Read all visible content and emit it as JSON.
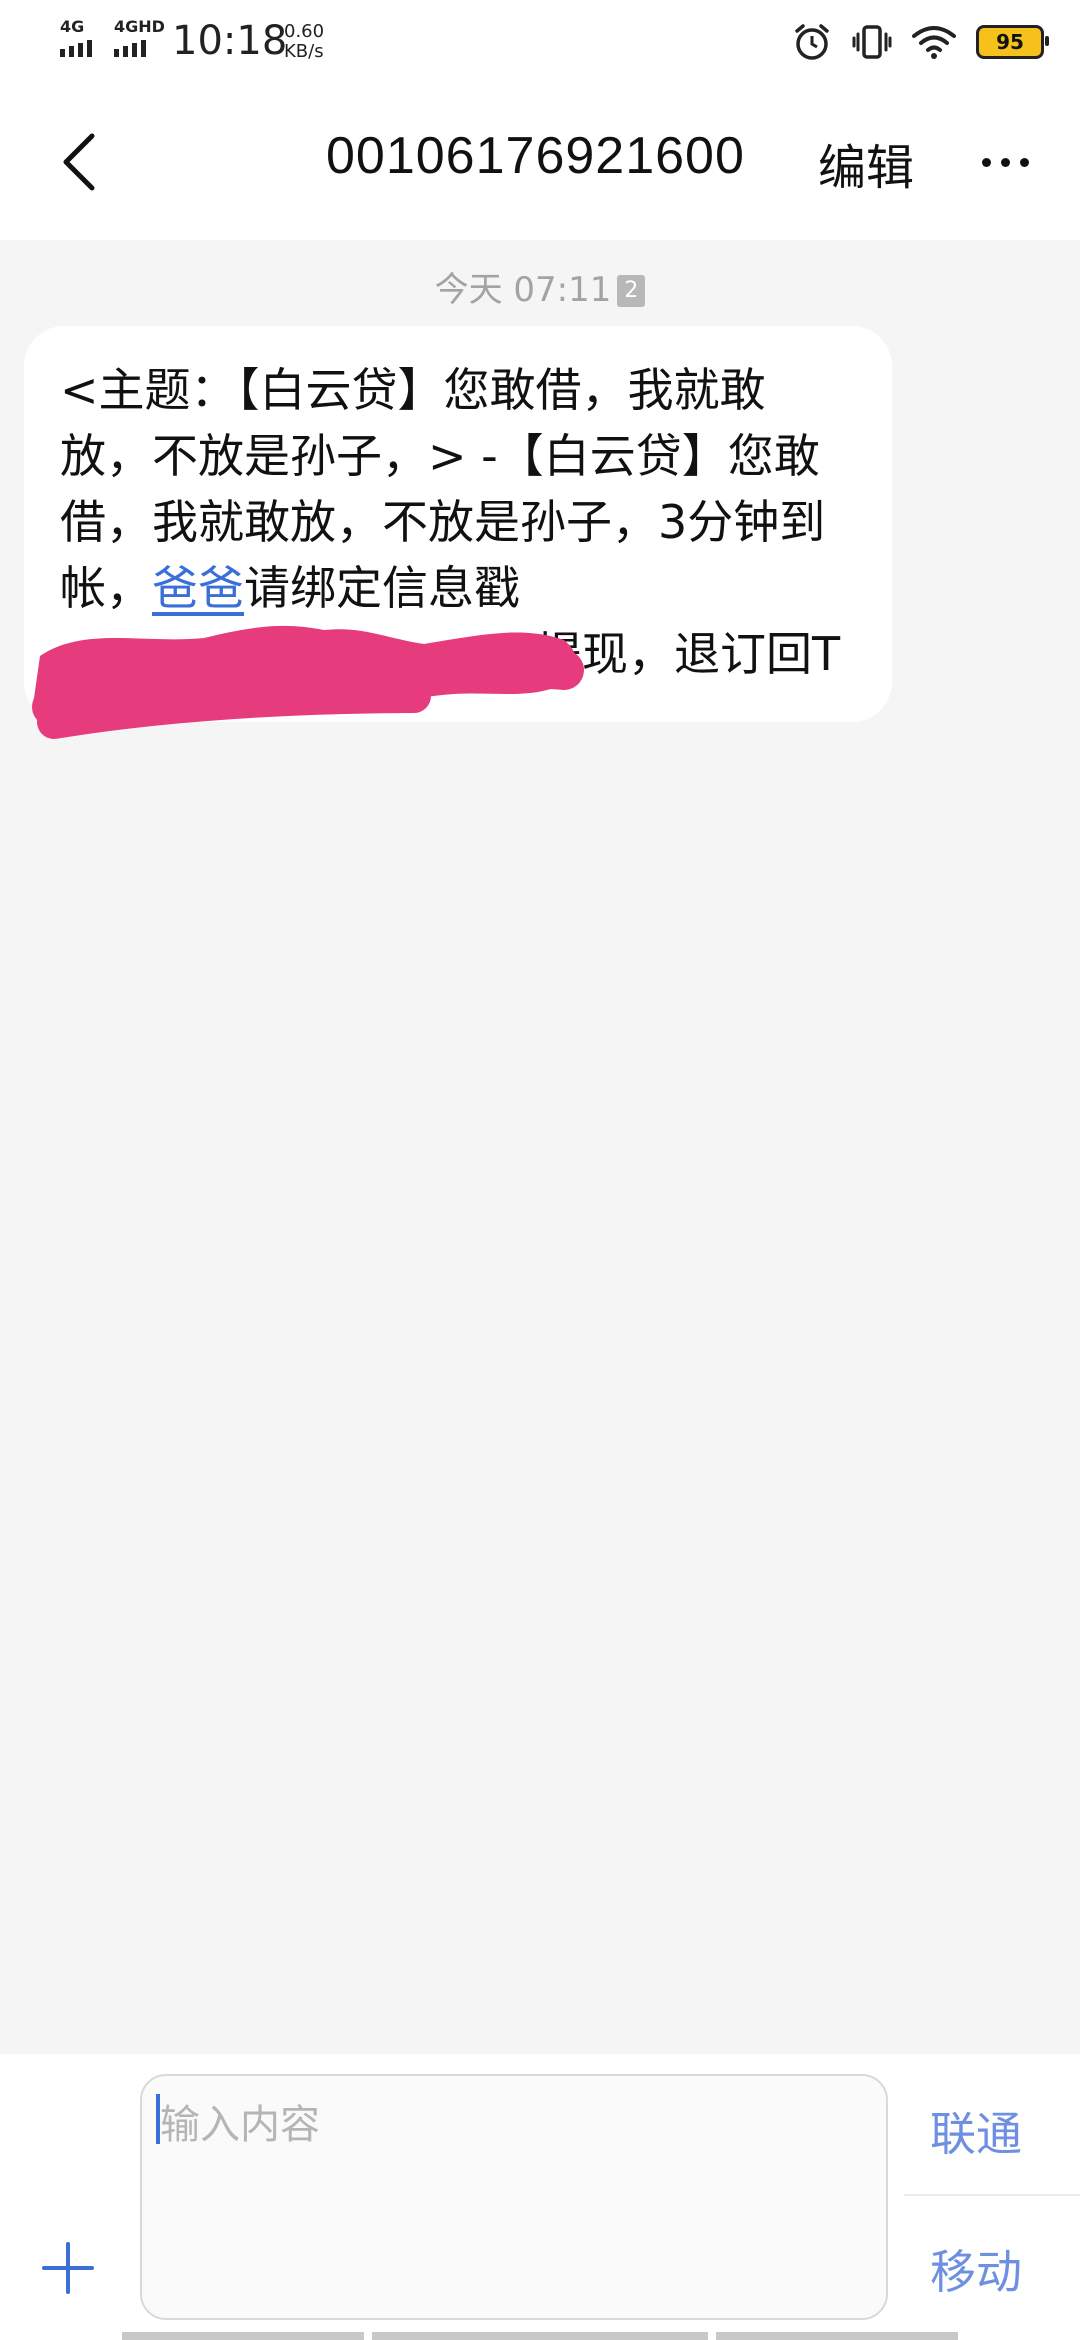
{
  "status_bar": {
    "signal_1": "4G",
    "signal_2": "4GHD",
    "time": "10:18",
    "net_speed_value": "0.60",
    "net_speed_unit": "KB/s",
    "battery": "95",
    "icons": [
      "alarm-icon",
      "vibrate-icon",
      "wifi-icon",
      "battery-icon"
    ]
  },
  "header": {
    "back_icon": "chevron-left-icon",
    "title": "00106176921600",
    "edit_label": "编辑",
    "more_icon": "more-dots-icon"
  },
  "conversation": {
    "timestamp": "今天 07:11",
    "sim_badge": "2",
    "message": {
      "line1": "<主题：【白云贷】您敢借，我就敢",
      "line2": "放，不放是孙子，> -【白云贷】您敢",
      "line3": "借，我就敢放，不放是孙子，3分钟到",
      "line4_prefix": "帐，",
      "line4_link": "爸爸",
      "line4_suffix": "请绑定信息戳",
      "line5_suffix": "提现，退订回T"
    }
  },
  "composer": {
    "placeholder": "输入内容",
    "sim1_label": "联通",
    "sim2_label": "移动",
    "plus_icon": "plus-icon"
  },
  "colors": {
    "accent": "#3b6fd8",
    "sim_button": "#6f8fe0",
    "redaction": "#e63c7d",
    "battery": "#f6c11a"
  }
}
